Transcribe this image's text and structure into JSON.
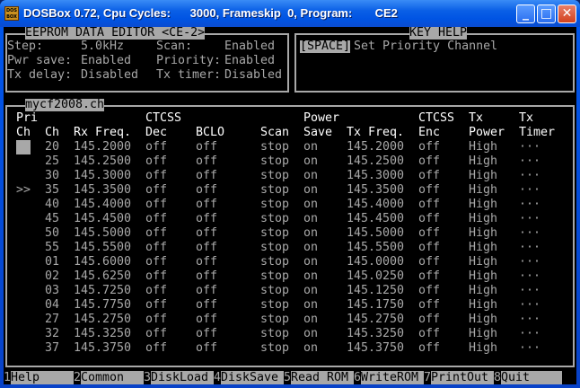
{
  "window": {
    "title": "DOSBox 0.72, Cpu Cycles:      3000, Frameskip  0, Program:       CE2",
    "buttons": [
      "minimize",
      "maximize",
      "close"
    ]
  },
  "editor": {
    "title": "EEPROM DATA EDITOR <CE-2>",
    "settings": [
      {
        "label": "Step:",
        "value": "5.0kHz"
      },
      {
        "label": "Scan:",
        "value": "Enabled"
      },
      {
        "label": "Pwr save:",
        "value": "Enabled"
      },
      {
        "label": "Priority:",
        "value": "Enabled"
      },
      {
        "label": "Tx delay:",
        "value": "Disabled"
      },
      {
        "label": "Tx timer:",
        "value": "Disabled"
      }
    ]
  },
  "key_help": {
    "title": "KEY HELP",
    "key": "[SPACE]",
    "text": "Set Priority Channel"
  },
  "file": {
    "name": "mycf2008.ch"
  },
  "table": {
    "headers_top": [
      "Pri",
      "",
      "",
      "CTCSS",
      "",
      "",
      "Power",
      "",
      "CTCSS",
      "Tx",
      "Tx"
    ],
    "headers": [
      "Ch",
      "Ch",
      "Rx Freq.",
      "Dec",
      "BCLO",
      "Scan",
      "Save",
      "Tx Freq.",
      "Enc",
      "Power",
      "Timer"
    ],
    "rows": [
      {
        "pri": "cursor",
        "ch": "20",
        "rx": "145.2000",
        "dec": "off",
        "bclo": "off",
        "scan": "stop",
        "save": "on",
        "tx": "145.2000",
        "enc": "off",
        "power": "High",
        "timer": "···"
      },
      {
        "pri": "",
        "ch": "25",
        "rx": "145.2500",
        "dec": "off",
        "bclo": "off",
        "scan": "stop",
        "save": "on",
        "tx": "145.2500",
        "enc": "off",
        "power": "High",
        "timer": "···"
      },
      {
        "pri": "",
        "ch": "30",
        "rx": "145.3000",
        "dec": "off",
        "bclo": "off",
        "scan": "stop",
        "save": "on",
        "tx": "145.3000",
        "enc": "off",
        "power": "High",
        "timer": "···"
      },
      {
        "pri": ">>",
        "ch": "35",
        "rx": "145.3500",
        "dec": "off",
        "bclo": "off",
        "scan": "stop",
        "save": "on",
        "tx": "145.3500",
        "enc": "off",
        "power": "High",
        "timer": "···"
      },
      {
        "pri": "",
        "ch": "40",
        "rx": "145.4000",
        "dec": "off",
        "bclo": "off",
        "scan": "stop",
        "save": "on",
        "tx": "145.4000",
        "enc": "off",
        "power": "High",
        "timer": "···"
      },
      {
        "pri": "",
        "ch": "45",
        "rx": "145.4500",
        "dec": "off",
        "bclo": "off",
        "scan": "stop",
        "save": "on",
        "tx": "145.4500",
        "enc": "off",
        "power": "High",
        "timer": "···"
      },
      {
        "pri": "",
        "ch": "50",
        "rx": "145.5000",
        "dec": "off",
        "bclo": "off",
        "scan": "stop",
        "save": "on",
        "tx": "145.5000",
        "enc": "off",
        "power": "High",
        "timer": "···"
      },
      {
        "pri": "",
        "ch": "55",
        "rx": "145.5500",
        "dec": "off",
        "bclo": "off",
        "scan": "stop",
        "save": "on",
        "tx": "145.5500",
        "enc": "off",
        "power": "High",
        "timer": "···"
      },
      {
        "pri": "",
        "ch": "01",
        "rx": "145.6000",
        "dec": "off",
        "bclo": "off",
        "scan": "stop",
        "save": "on",
        "tx": "145.0000",
        "enc": "off",
        "power": "High",
        "timer": "···"
      },
      {
        "pri": "",
        "ch": "02",
        "rx": "145.6250",
        "dec": "off",
        "bclo": "off",
        "scan": "stop",
        "save": "on",
        "tx": "145.0250",
        "enc": "off",
        "power": "High",
        "timer": "···"
      },
      {
        "pri": "",
        "ch": "03",
        "rx": "145.7250",
        "dec": "off",
        "bclo": "off",
        "scan": "stop",
        "save": "on",
        "tx": "145.1250",
        "enc": "off",
        "power": "High",
        "timer": "···"
      },
      {
        "pri": "",
        "ch": "04",
        "rx": "145.7750",
        "dec": "off",
        "bclo": "off",
        "scan": "stop",
        "save": "on",
        "tx": "145.1750",
        "enc": "off",
        "power": "High",
        "timer": "···"
      },
      {
        "pri": "",
        "ch": "27",
        "rx": "145.2750",
        "dec": "off",
        "bclo": "off",
        "scan": "stop",
        "save": "on",
        "tx": "145.2750",
        "enc": "off",
        "power": "High",
        "timer": "···"
      },
      {
        "pri": "",
        "ch": "32",
        "rx": "145.3250",
        "dec": "off",
        "bclo": "off",
        "scan": "stop",
        "save": "on",
        "tx": "145.3250",
        "enc": "off",
        "power": "High",
        "timer": "···"
      },
      {
        "pri": "",
        "ch": "37",
        "rx": "145.3750",
        "dec": "off",
        "bclo": "off",
        "scan": "stop",
        "save": "on",
        "tx": "145.3750",
        "enc": "off",
        "power": "High",
        "timer": "···"
      }
    ]
  },
  "function_keys": [
    {
      "num": "1",
      "label": "Help    "
    },
    {
      "num": "2",
      "label": "Common  "
    },
    {
      "num": "3",
      "label": "DiskLoad"
    },
    {
      "num": "4",
      "label": "DiskSave"
    },
    {
      "num": "5",
      "label": "Read ROM"
    },
    {
      "num": "6",
      "label": "WriteROM"
    },
    {
      "num": "7",
      "label": "PrintOut"
    },
    {
      "num": "8",
      "label": "Quit        "
    }
  ]
}
